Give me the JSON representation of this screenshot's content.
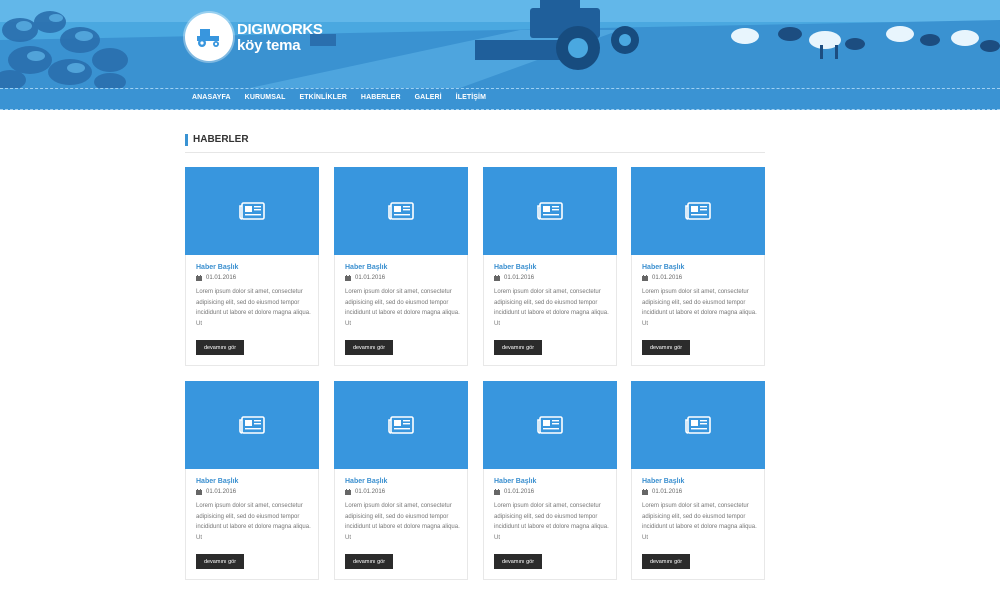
{
  "brand": {
    "line1": "DIGIWORKS",
    "line2": "köy tema"
  },
  "nav": [
    "ANASAYFA",
    "KURUMSAL",
    "ETKİNLİKLER",
    "HABERLER",
    "GALERİ",
    "İLETİŞİM"
  ],
  "section": {
    "title": "HABERLER"
  },
  "cards": [
    {
      "title": "Haber Başlık",
      "date": "01.01.2016",
      "excerpt": "Lorem ipsum dolor sit amet, consectetur adipisicing elit, sed do eiusmod tempor incididunt ut labore et dolore magna aliqua. Ut",
      "more": "devamını gör"
    },
    {
      "title": "Haber Başlık",
      "date": "01.01.2016",
      "excerpt": "Lorem ipsum dolor sit amet, consectetur adipisicing elit, sed do eiusmod tempor incididunt ut labore et dolore magna aliqua. Ut",
      "more": "devamını gör"
    },
    {
      "title": "Haber Başlık",
      "date": "01.01.2016",
      "excerpt": "Lorem ipsum dolor sit amet, consectetur adipisicing elit, sed do eiusmod tempor incididunt ut labore et dolore magna aliqua. Ut",
      "more": "devamını gör"
    },
    {
      "title": "Haber Başlık",
      "date": "01.01.2016",
      "excerpt": "Lorem ipsum dolor sit amet, consectetur adipisicing elit, sed do eiusmod tempor incididunt ut labore et dolore magna aliqua. Ut",
      "more": "devamını gör"
    },
    {
      "title": "Haber Başlık",
      "date": "01.01.2016",
      "excerpt": "Lorem ipsum dolor sit amet, consectetur adipisicing elit, sed do eiusmod tempor incididunt ut labore et dolore magna aliqua. Ut",
      "more": "devamını gör"
    },
    {
      "title": "Haber Başlık",
      "date": "01.01.2016",
      "excerpt": "Lorem ipsum dolor sit amet, consectetur adipisicing elit, sed do eiusmod tempor incididunt ut labore et dolore magna aliqua. Ut",
      "more": "devamını gör"
    },
    {
      "title": "Haber Başlık",
      "date": "01.01.2016",
      "excerpt": "Lorem ipsum dolor sit amet, consectetur adipisicing elit, sed do eiusmod tempor incididunt ut labore et dolore magna aliqua. Ut",
      "more": "devamını gör"
    },
    {
      "title": "Haber Başlık",
      "date": "01.01.2016",
      "excerpt": "Lorem ipsum dolor sit amet, consectetur adipisicing elit, sed do eiusmod tempor incididunt ut labore et dolore magna aliqua. Ut",
      "more": "devamını gör"
    }
  ],
  "icons": {
    "logo": "tractor-icon",
    "thumb": "newspaper-icon",
    "date": "calendar-icon"
  },
  "colors": {
    "primary": "#3896de",
    "nav": "#3a93d3",
    "button": "#2b2b2b",
    "title": "#3a8fcf"
  }
}
